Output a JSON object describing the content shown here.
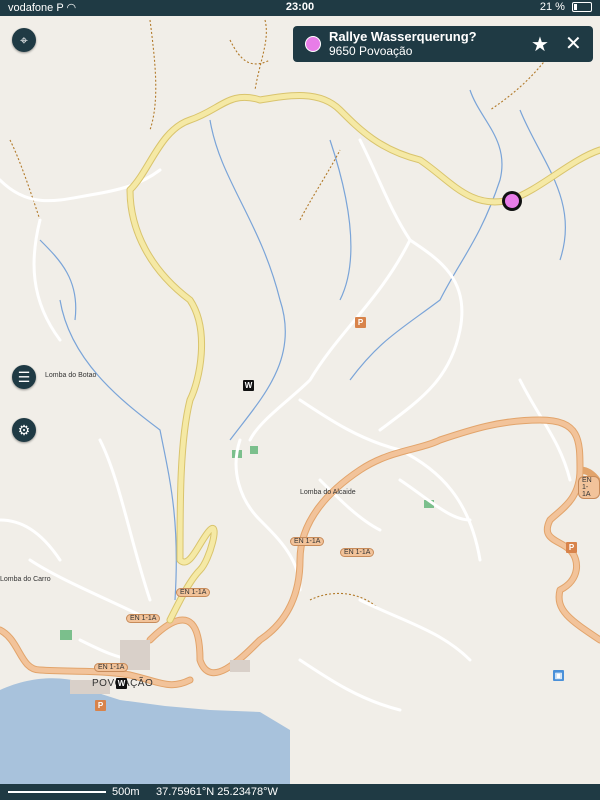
{
  "status_bar": {
    "carrier": "vodafone P",
    "time": "23:00",
    "battery": "21 %"
  },
  "popup": {
    "title": "Rallye Wasserquerung?",
    "subtitle": "9650 Povoação",
    "marker_color": "#e87de8"
  },
  "map": {
    "places": [
      "Lomba do Botao",
      "Lomba do Alcaide",
      "Lomba do Carro",
      "POVOAÇÃO"
    ],
    "roads": [
      "EN 1-1A",
      "EN 1-1A",
      "EN 1-1A",
      "EN 1-1A",
      "EN 1-1A",
      "EN 1-1A"
    ],
    "poi_parking": "P",
    "poi_wiki": "W"
  },
  "bottom_bar": {
    "scale": "500m",
    "coordinates": "37.75961°N 25.23478°W"
  },
  "colors": {
    "ui_bar": "#1f3a44",
    "land": "#f1eee8",
    "sea": "#a8c2dc",
    "primary_road": "#f5e9a5",
    "secondary_road": "#f2c39a",
    "water": "#7aa4d8",
    "track": "#b27a2a"
  },
  "icons": [
    "locate-icon",
    "menu-icon",
    "settings-icon",
    "star-icon",
    "close-icon",
    "wifi-icon",
    "battery-icon"
  ]
}
